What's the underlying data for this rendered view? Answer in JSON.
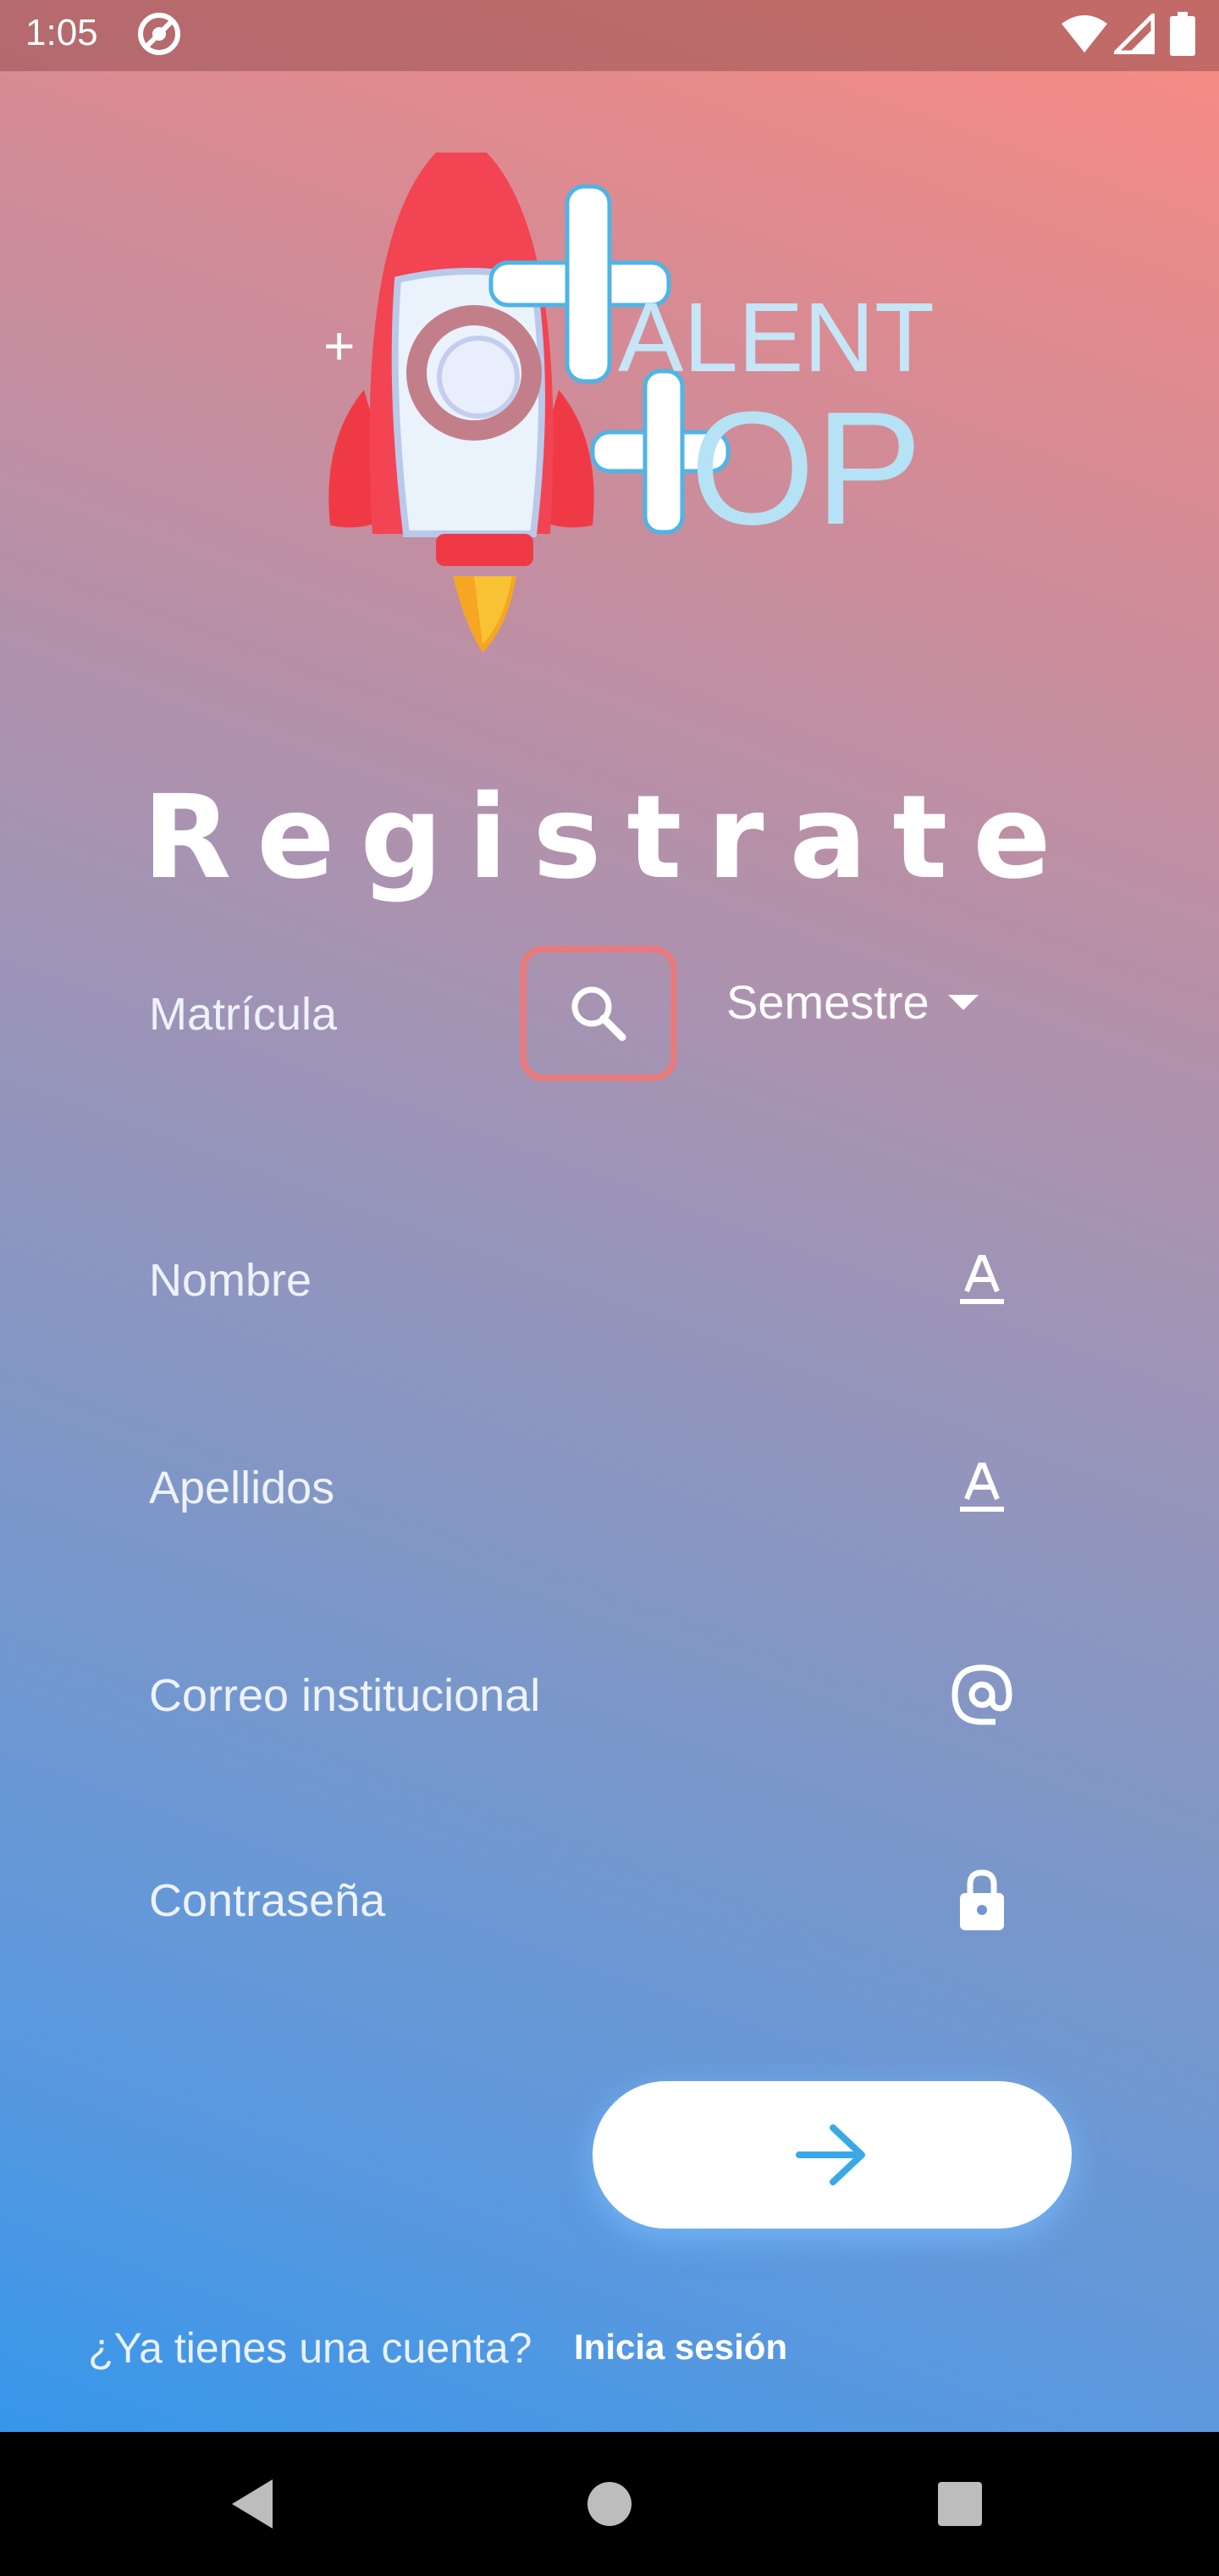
{
  "status_bar": {
    "time": "1:05"
  },
  "logo": {
    "brand_line1": "ALENT",
    "brand_line2": "OP"
  },
  "title": "Registrate",
  "form": {
    "matricula_label": "Matrícula",
    "semestre_label": "Semestre",
    "nombre_label": "Nombre",
    "apellidos_label": "Apellidos",
    "correo_label": "Correo institucional",
    "password_label": "Contraseña"
  },
  "footer": {
    "question": "¿Ya tienes una cuenta?",
    "login_link": "Inicia sesión"
  },
  "colors": {
    "gradient_top": "#fa8b82",
    "gradient_bottom": "#2a96ee",
    "search_border": "#e57a7f",
    "arrow": "#3aa8e6"
  },
  "icons": [
    "do-not-disturb-icon",
    "wifi-icon",
    "signal-icon",
    "battery-icon",
    "rocket-logo",
    "search-icon",
    "text-format-icon",
    "at-icon",
    "lock-icon",
    "arrow-right-icon",
    "back-icon",
    "home-icon",
    "recents-icon"
  ]
}
